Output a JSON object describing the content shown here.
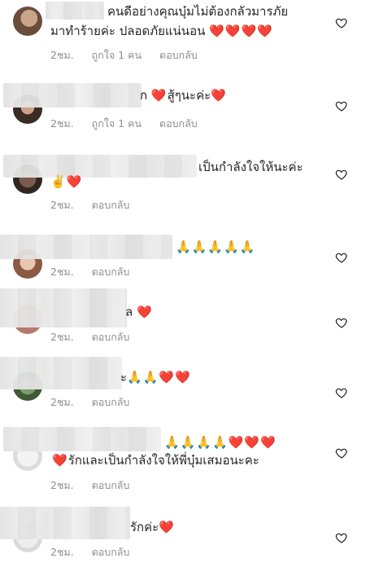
{
  "comments": [
    {
      "text_line1": "คนดีอย่างคุณบุ๋มไม่ต้องกลัวมารภัย",
      "text_line2": "มาทำร้ายค่ะ ปลอดภัยแน่นอน",
      "emoji": "❤️❤️❤️❤️",
      "time": "2ชม.",
      "likes": "ถูกใจ 1 คน",
      "reply": "ตอบกลับ"
    },
    {
      "text_line1": "ก",
      "emoji_before": "❤️",
      "text_after": "สู้ๆนะค่ะ",
      "emoji": "❤️",
      "time": "2ชม.",
      "likes": "ถูกใจ 1 คน",
      "reply": "ตอบกลับ"
    },
    {
      "text_line1": "เป็นกำลังใจให้นะค่ะ",
      "emoji": "✌️❤️",
      "time": "2ชม.",
      "reply": "ตอบกลับ"
    },
    {
      "emoji": "🙏🙏🙏🙏🙏",
      "time": "2ชม.",
      "reply": "ตอบกลับ"
    },
    {
      "text_line1": "ล",
      "emoji": "❤️",
      "time": "2ชม.",
      "reply": "ตอบกลับ"
    },
    {
      "text_line1": "ะ",
      "emoji": "🙏🙏❤️❤️",
      "time": "2ชม.",
      "reply": "ตอบกลับ"
    },
    {
      "emoji": "🙏🙏🙏🙏❤️❤️❤️",
      "text_line2": "รักและเป็นกำลังใจให้พี่บุ๋มเสมอนะคะ",
      "emoji2": "❤️",
      "time": "2ชม.",
      "reply": "ตอบกลับ"
    },
    {
      "text_line1": "รักค่ะ",
      "emoji": "❤️",
      "time": "2ชม.",
      "reply": "ตอบกลับ"
    }
  ],
  "icons": {
    "like": "heart-outline-icon"
  },
  "colors": {
    "heart_red": "#e0245e",
    "meta_gray": "#8e8e8e"
  }
}
